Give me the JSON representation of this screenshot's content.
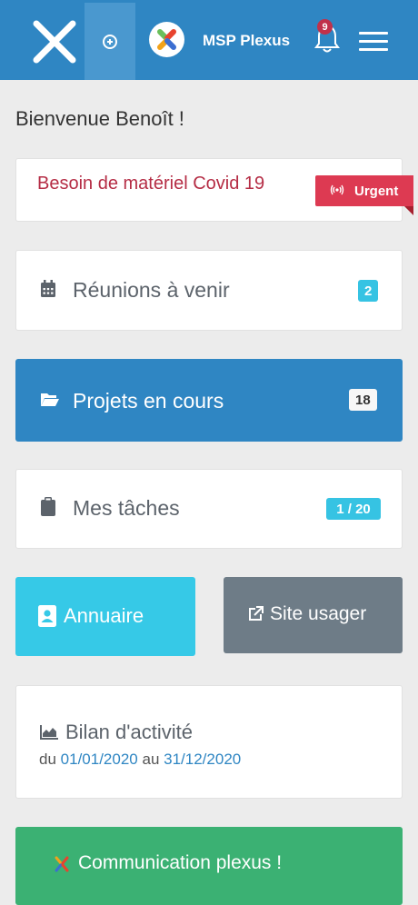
{
  "header": {
    "org_name": "MSP Plexus",
    "notification_count": "9",
    "colors": {
      "bar": "#2f86c3",
      "active": "#4a98cf"
    }
  },
  "welcome": "Bienvenue Benoît !",
  "alert": {
    "text": "Besoin de matériel Covid 19",
    "badge": "Urgent",
    "color": "#dd3a52"
  },
  "items": {
    "meetings": {
      "label": "Réunions à venir",
      "count": "2"
    },
    "projects": {
      "label": "Projets en cours",
      "count": "18"
    },
    "tasks": {
      "label": "Mes tâches",
      "count": "1 / 20"
    }
  },
  "buttons": {
    "directory": "Annuaire",
    "user_site": "Site usager"
  },
  "activity": {
    "title": "Bilan d'activité",
    "from_word": "du",
    "from": "01/01/2020",
    "to_word": "au",
    "to": "31/12/2020"
  },
  "communication": "Communication plexus !"
}
